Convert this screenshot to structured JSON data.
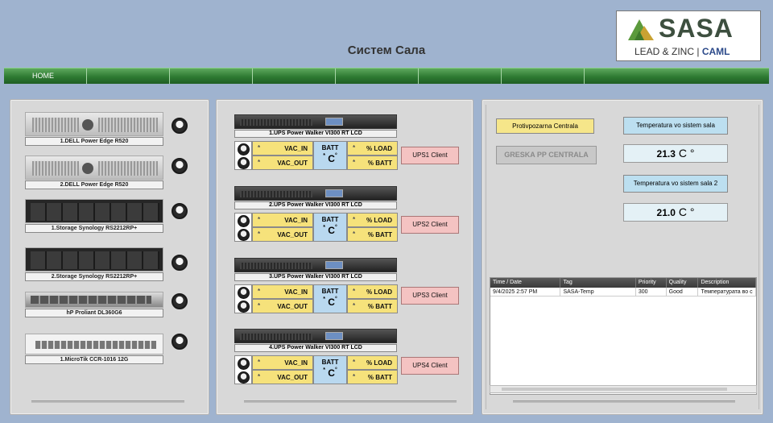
{
  "header": {
    "title": "Систем Сала"
  },
  "logo": {
    "brand": "SASA",
    "sub_left": "LEAD & ZINC",
    "sub_right": "CAML"
  },
  "nav": {
    "items": [
      "HOME",
      "",
      "",
      "",
      "",
      "",
      "",
      ""
    ]
  },
  "servers": [
    {
      "label": "1.DELL Power Edge R520"
    },
    {
      "label": "2.DELL Power Edge R520"
    },
    {
      "label": "1.Storage Synology RS2212RP+"
    },
    {
      "label": "2.Storage Synology RS2212RP+"
    },
    {
      "label": "hP Proliant DL360G6"
    },
    {
      "label": "1.MicroTik CCR-1016 12G"
    }
  ],
  "ups_units": [
    {
      "label": "1.UPS Power Walker VI300 RT LCD",
      "client": "UPS1 Client"
    },
    {
      "label": "2.UPS Power Walker VI300 RT LCD",
      "client": "UPS2 Client"
    },
    {
      "label": "3.UPS Power Walker VI300 RT LCD",
      "client": "UPS3 Client"
    },
    {
      "label": "4.UPS Power Walker VI300 RT LCD",
      "client": "UPS4 Client"
    }
  ],
  "ups_fields": {
    "vac_in": "VAC_IN",
    "vac_out": "VAC_OUT",
    "batt": "BATT",
    "pct_load": "% LOAD",
    "pct_batt": "% BATT",
    "placeholder": "*",
    "batt_unit": "C",
    "degree": "°"
  },
  "right_panel": {
    "fire_central": "Protivpozarna Centrala",
    "fire_error": "GRESKA PP CENTRALA",
    "temp1_label": "Temperatura vo sistem sala",
    "temp1_value": "21.3",
    "temp2_label": "Temperatura vo sistem sala 2",
    "temp2_value": "21.0",
    "temp_unit": "C °"
  },
  "alarm_table": {
    "columns": [
      "Time / Date",
      "Tag",
      "Priority",
      "Quality",
      "Description"
    ],
    "rows": [
      [
        "9/4/2025 2:57 PM",
        "SASA-Temp",
        "300",
        "Good",
        "Температурата во с"
      ]
    ]
  }
}
